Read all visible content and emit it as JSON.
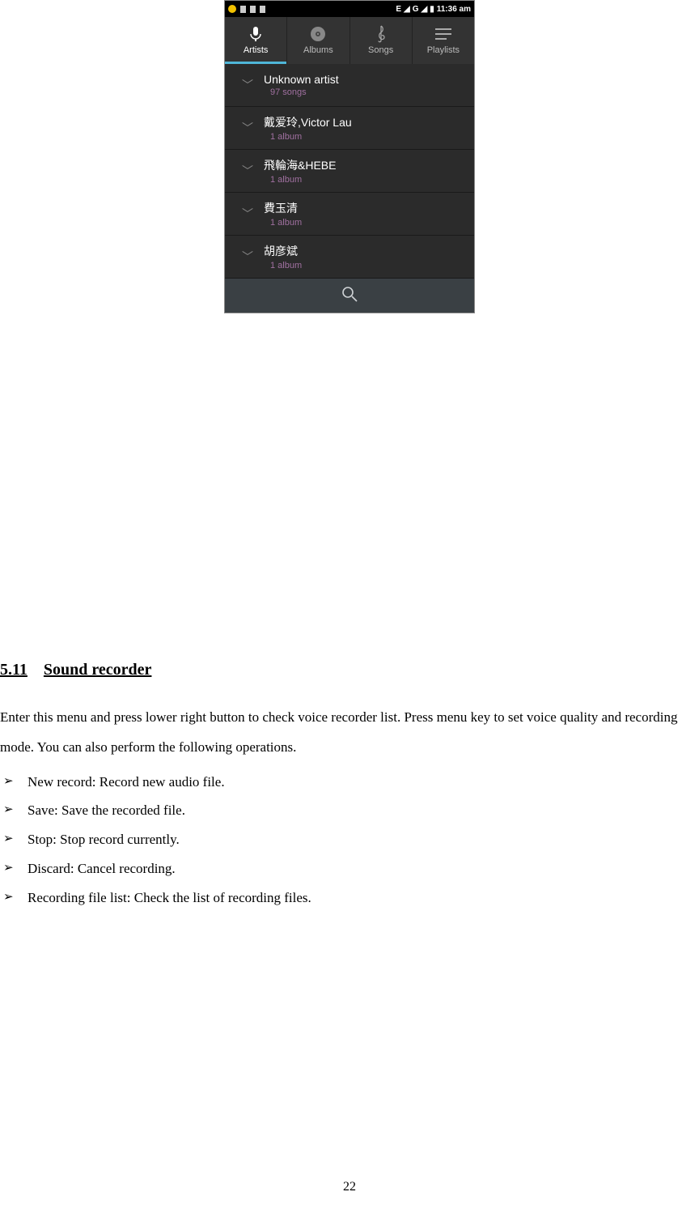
{
  "statusbar": {
    "signal_text": "E",
    "signal_text2": "G",
    "time": "11:36 am"
  },
  "tabs": [
    {
      "label": "Artists",
      "active": true
    },
    {
      "label": "Albums",
      "active": false
    },
    {
      "label": "Songs",
      "active": false
    },
    {
      "label": "Playlists",
      "active": false
    }
  ],
  "artists": [
    {
      "name": "Unknown artist",
      "sub": "97 songs"
    },
    {
      "name": "戴爱玲,Victor Lau",
      "sub": "1 album"
    },
    {
      "name": "飛輪海&HEBE",
      "sub": "1 album"
    },
    {
      "name": "費玉清",
      "sub": "1 album"
    },
    {
      "name": "胡彦斌",
      "sub": "1 album"
    }
  ],
  "section": {
    "num": "5.11",
    "title": "Sound recorder",
    "intro": "Enter this menu and press lower right button to check voice recorder list. Press menu key to set voice quality and recording mode. You can also perform the following operations.",
    "bullets": [
      "New record: Record new audio file.",
      "Save: Save the recorded file.",
      "Stop: Stop record currently.",
      "Discard: Cancel recording.",
      "Recording file list: Check the list of recording files."
    ]
  },
  "page_number": "22"
}
